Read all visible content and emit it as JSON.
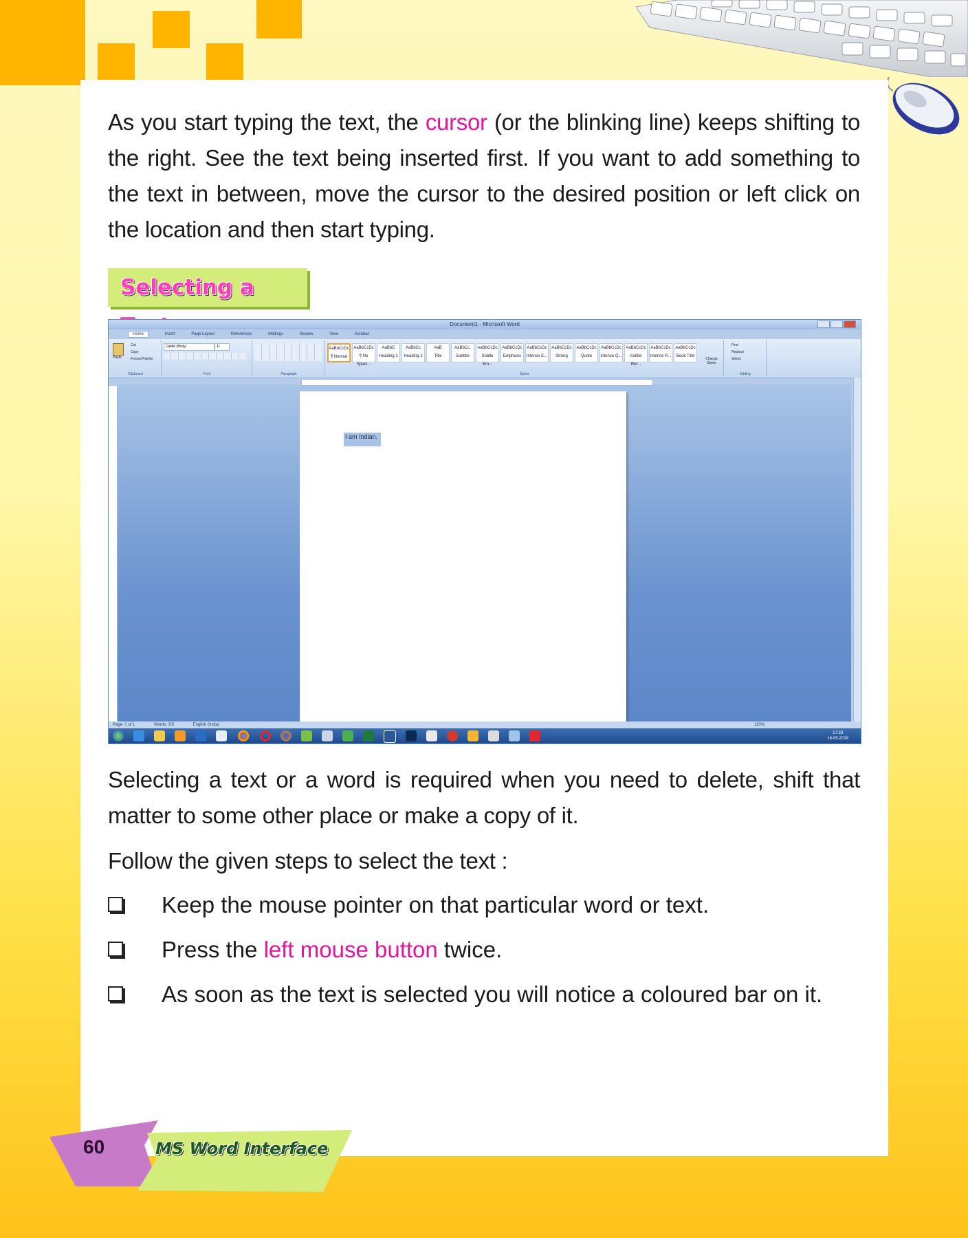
{
  "intro_paragraph": {
    "part1": "As you start typing the text, the ",
    "highlight": "cursor",
    "part2": " (or the blinking line) keeps shifting to the right. See the text being inserted first. If you want to add something to the text in between, move the cursor to the desired position or left click on the location and then start typing."
  },
  "section_heading": "Selecting a Text",
  "screenshot": {
    "window_title": "Document1 - Microsoft Word",
    "tabs": [
      "Home",
      "Insert",
      "Page Layout",
      "References",
      "Mailings",
      "Review",
      "View",
      "Acrobat"
    ],
    "clipboard": {
      "paste": "Paste",
      "cut": "Cut",
      "copy": "Copy",
      "format_painter": "Format Painter",
      "label": "Clipboard"
    },
    "font": {
      "name": "Calibri (Body)",
      "size": "11",
      "label": "Font"
    },
    "paragraph_label": "Paragraph",
    "styles": [
      {
        "preview": "AaBbCcDc",
        "name": "¶ Normal"
      },
      {
        "preview": "AaBbCcDc",
        "name": "¶ No Spaci..."
      },
      {
        "preview": "AaBbC",
        "name": "Heading 1"
      },
      {
        "preview": "AaBbCc",
        "name": "Heading 2"
      },
      {
        "preview": "AaB",
        "name": "Title"
      },
      {
        "preview": "AaBbCc.",
        "name": "Subtitle"
      },
      {
        "preview": "AaBbCcDc",
        "name": "Subtle Em..."
      },
      {
        "preview": "AaBbCcDc",
        "name": "Emphasis"
      },
      {
        "preview": "AaBbCcDc",
        "name": "Intense E..."
      },
      {
        "preview": "AaBbCcDc",
        "name": "Strong"
      },
      {
        "preview": "AaBbCcDc",
        "name": "Quote"
      },
      {
        "preview": "AaBbCcDc",
        "name": "Intense Q..."
      },
      {
        "preview": "AaBbCcDc",
        "name": "Subtle Ref..."
      },
      {
        "preview": "AaBbCcDc",
        "name": "Intense R..."
      },
      {
        "preview": "AaBbCcDc",
        "name": "Book Title"
      }
    ],
    "styles_label": "Styles",
    "change_styles": "Change Styles",
    "editing": {
      "find": "Find",
      "replace": "Replace",
      "select": "Select",
      "label": "Editing"
    },
    "document_text": "I am Indian.",
    "status": {
      "page": "Page: 1 of 1",
      "words": "Words: 3/3",
      "language": "English (India)",
      "zoom": "110%"
    },
    "clock": {
      "time": "17:33",
      "date": "16-05-2018"
    }
  },
  "body_paragraph_1": "Selecting a text or a word is required when you need to delete, shift that matter to some other place or make a copy of it.",
  "body_paragraph_2": "Follow the given steps to select the text :",
  "steps": [
    {
      "before": "Keep the mouse pointer on that particular word or text.",
      "highlight": "",
      "after": ""
    },
    {
      "before": "Press the ",
      "highlight": "left mouse button",
      "after": " twice."
    },
    {
      "before": "As soon as the text is selected you will notice a coloured bar on it.",
      "highlight": "",
      "after": ""
    }
  ],
  "footer": {
    "page_number": "60",
    "chapter": "MS Word Interface"
  },
  "colors": {
    "accent_pink": "#e0169a",
    "heading_bg": "#d3ec7a",
    "orange": "#ffb400",
    "footer_green": "#d3ec7a",
    "footer_purple": "#c77ac8"
  }
}
